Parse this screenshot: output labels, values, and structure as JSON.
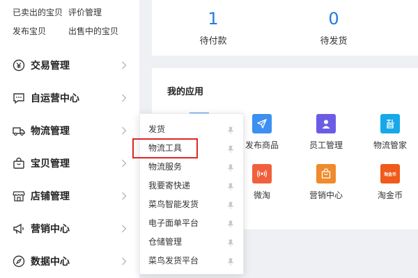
{
  "sidebar": {
    "quick_links": [
      "已卖出的宝贝",
      "评价管理",
      "发布宝贝",
      "出售中的宝贝"
    ],
    "items": [
      {
        "label": "交易管理",
        "icon": "yen-circle-icon"
      },
      {
        "label": "自运营中心",
        "icon": "chat-bubble-icon"
      },
      {
        "label": "物流管理",
        "icon": "truck-icon"
      },
      {
        "label": "宝贝管理",
        "icon": "bag-icon"
      },
      {
        "label": "店铺管理",
        "icon": "store-icon"
      },
      {
        "label": "营销中心",
        "icon": "megaphone-icon"
      },
      {
        "label": "数据中心",
        "icon": "compass-icon"
      }
    ]
  },
  "stats": [
    {
      "value": "1",
      "label": "待付款"
    },
    {
      "value": "0",
      "label": "待发货"
    }
  ],
  "apps": {
    "title": "我的应用",
    "items": [
      {
        "label": "发布商品",
        "icon": "paper-plane-icon",
        "color": "#3d8ff0"
      },
      {
        "label": "员工管理",
        "icon": "employee-icon",
        "color": "#6b5ce7"
      },
      {
        "label": "物流管家",
        "icon": "zhi-icon",
        "color": "#17a8e8"
      },
      {
        "label": "微淘",
        "icon": "broadcast-icon",
        "color": "#f0603d"
      },
      {
        "label": "营销中心",
        "icon": "gift-bag-icon",
        "color": "#f08a2c"
      },
      {
        "label": "淘金币",
        "icon": "taojinbi-icon",
        "color": "#f05a1a",
        "badge": "淘金币"
      }
    ]
  },
  "flyout": {
    "items": [
      "发货",
      "物流工具",
      "物流服务",
      "我要寄快递",
      "菜鸟智能发货",
      "电子面单平台",
      "仓储管理",
      "菜鸟发货平台"
    ],
    "highlighted": "物流工具"
  },
  "colors": {
    "accent": "#1e7be4",
    "highlight": "#e02424"
  }
}
